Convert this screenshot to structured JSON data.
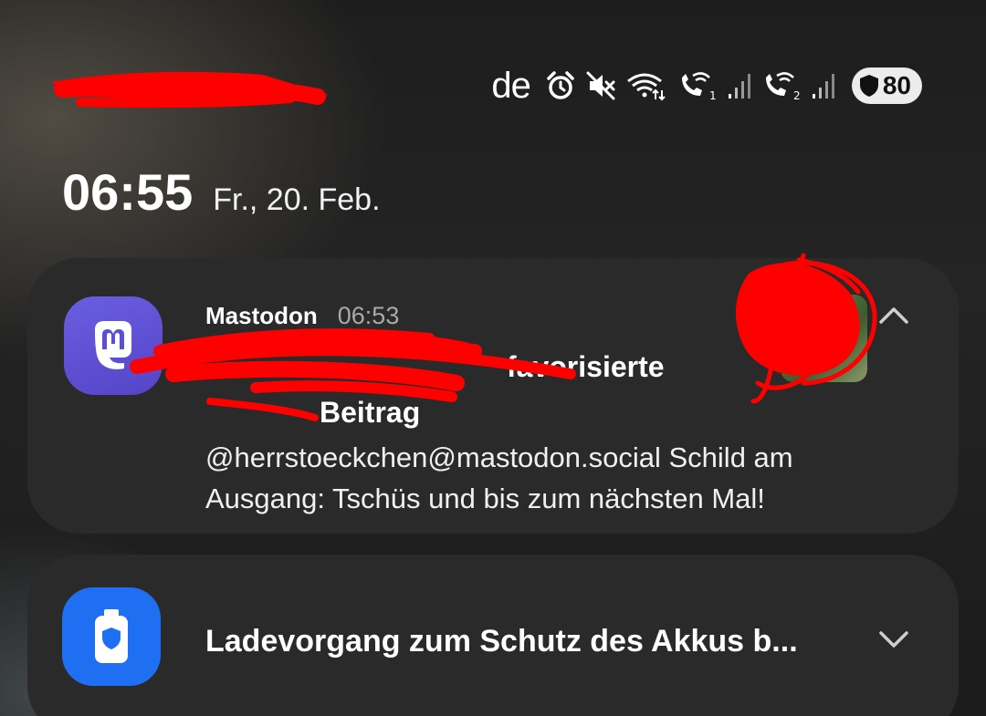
{
  "status_bar": {
    "carrier": "de",
    "battery_level": "80",
    "icons": [
      "alarm-icon",
      "mute-icon",
      "wifi-calling-icon",
      "wifi-call-sim1-icon",
      "signal-icon",
      "wifi-call-sim2-icon",
      "signal-icon",
      "shield-icon"
    ]
  },
  "lockscreen": {
    "time": "06:55",
    "date": "Fr., 20. Feb."
  },
  "notifications": [
    {
      "app_name": "Mastodon",
      "time": "06:53",
      "title_visible_fragment": "favorisierte",
      "title_line2_fragment": "Beitrag",
      "body": "@herrstoeckchen@mastodon.social Schild am Ausgang: Tschüs und bis zum nächsten Mal!",
      "icon": "mastodon-icon",
      "expanded": true
    },
    {
      "title": "Ladevorgang zum Schutz des Akkus b...",
      "icon": "battery-protect-icon",
      "expanded": false
    }
  ],
  "colors": {
    "mastodon_purple": "#5c4ed6",
    "battery_blue": "#1f6ff2",
    "card_bg": "#2a2a2a",
    "redaction_red": "#ff0000"
  }
}
